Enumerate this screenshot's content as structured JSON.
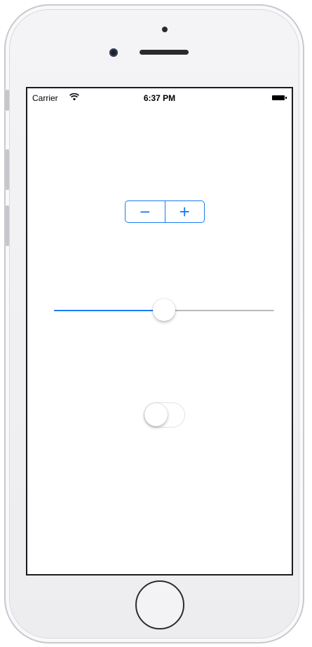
{
  "status_bar": {
    "carrier": "Carrier",
    "wifi_icon": "wifi-icon",
    "time": "6:37 PM",
    "battery_icon": "battery-icon"
  },
  "stepper": {
    "decrement_label": "−",
    "increment_label": "+",
    "accent_color": "#1a7cf5"
  },
  "slider": {
    "value": 0.5,
    "min": 0,
    "max": 1,
    "fill_color": "#1a7cf5",
    "track_color": "#b9b9bd"
  },
  "toggle": {
    "on": false
  },
  "device": {
    "home_button_icon": "home-button"
  }
}
